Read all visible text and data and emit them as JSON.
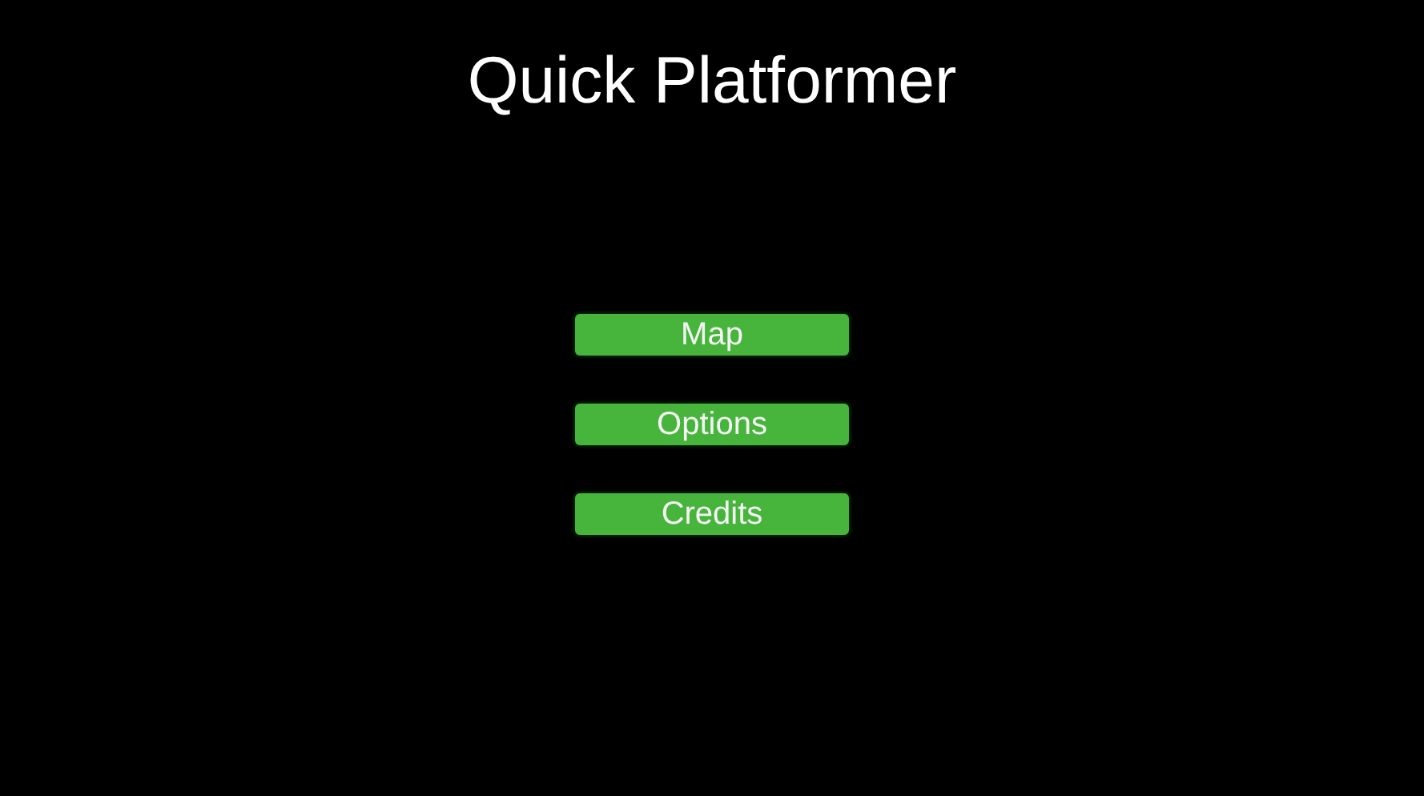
{
  "title": "Quick Platformer",
  "menu": [
    {
      "label": "Map"
    },
    {
      "label": "Options"
    },
    {
      "label": "Credits"
    }
  ]
}
